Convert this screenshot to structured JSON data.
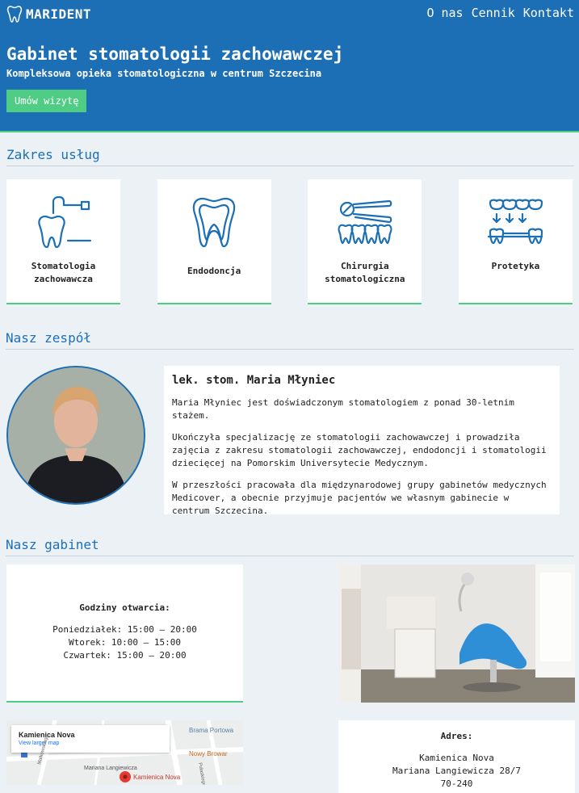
{
  "header": {
    "brand": "MARIDENT",
    "nav": [
      "O nas",
      "Cennik",
      "Kontakt"
    ],
    "title": "Gabinet stomatologii zachowawczej",
    "subtitle": "Kompleksowa opieka stomatologiczna w centrum Szczecina",
    "cta": "Umów wizytę"
  },
  "services": {
    "title": "Zakres usług",
    "items": [
      {
        "line1": "Stomatologia",
        "line2": "zachowawcza",
        "icon": "tooth-drill-icon"
      },
      {
        "line1": "Endodoncja",
        "line2": "",
        "icon": "tooth-root-icon"
      },
      {
        "line1": "Chirurgia",
        "line2": "stomatologiczna",
        "icon": "tooth-extraction-icon"
      },
      {
        "line1": "Protetyka",
        "line2": "",
        "icon": "dental-bridge-icon"
      }
    ]
  },
  "team": {
    "title": "Nasz zespół",
    "name": "lek. stom. Maria Młyniec",
    "p1": "Maria Młyniec jest doświadczonym stomatologiem z ponad 30-letnim stażem.",
    "p2": "Ukończyła specjalizację ze stomatologii zachowawczej i prowadziła zajęcia z zakresu stomatologii zachowawczej, endodoncji i stomatologii dziecięcej na Pomorskim Universytecie Medycznym.",
    "p3": "W przeszłości pracowała dla międzynarodowej grupy gabinetów medycznych Medicover, a obecnie przyjmuje pacjentów we własnym gabinecie w centrum Szczecina."
  },
  "clinic": {
    "title": "Nasz gabinet",
    "hours_title": "Godziny otwarcia:",
    "hours": [
      "Poniedziałek: 15:00 – 20:00",
      "Wtorek: 10:00 – 15:00",
      "Czwartek: 15:00 – 20:00"
    ],
    "map": {
      "place": "Kamienica Nova",
      "link": "View larger map",
      "labels": [
        "Brama Portowa",
        "Nowy Browar",
        "Mariana Langiewicza",
        "Kamienica Nova",
        "Pułaskiego",
        "Małkowskiego"
      ]
    },
    "address_title": "Adres:",
    "address": [
      "Kamienica Nova",
      "Mariana Langiewicza 28/7",
      "70-240"
    ]
  },
  "colors": {
    "primary": "#1d6fb5",
    "accent": "#4fcd84",
    "background": "#ecf1f6"
  }
}
